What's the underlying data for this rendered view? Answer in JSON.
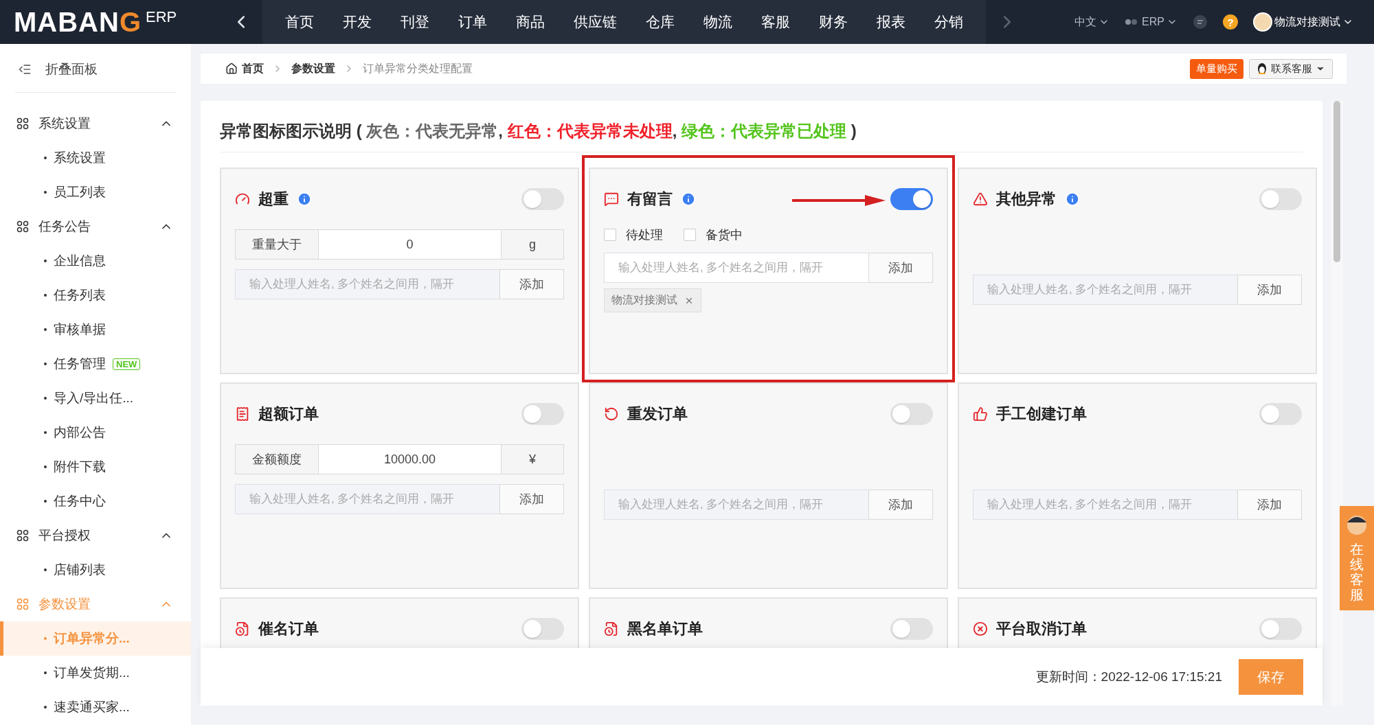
{
  "top_nav": {
    "logo": {
      "text": "MABAN",
      "mark": "G",
      "suffix": "ERP"
    },
    "items": [
      {
        "label": "首页",
        "selected": false
      },
      {
        "label": "开发",
        "selected": false
      },
      {
        "label": "刊登",
        "selected": false
      },
      {
        "label": "订单",
        "selected": false
      },
      {
        "label": "商品",
        "selected": false
      },
      {
        "label": "供应链",
        "selected": false
      },
      {
        "label": "仓库",
        "selected": false
      },
      {
        "label": "物流",
        "selected": false
      },
      {
        "label": "客服",
        "selected": false
      },
      {
        "label": "财务",
        "selected": false
      },
      {
        "label": "报表",
        "selected": false
      },
      {
        "label": "分销",
        "selected": false
      }
    ],
    "language": "中文",
    "system": "ERP",
    "help": "?",
    "user": "物流对接测试"
  },
  "sidebar": {
    "collapse_label": "折叠面板",
    "groups": [
      {
        "label": "系统设置",
        "expanded": true,
        "selected": false,
        "children": [
          {
            "label": "系统设置",
            "selected": false
          },
          {
            "label": "员工列表",
            "selected": false
          }
        ]
      },
      {
        "label": "任务公告",
        "expanded": true,
        "selected": false,
        "children": [
          {
            "label": "企业信息",
            "selected": false
          },
          {
            "label": "任务列表",
            "selected": false
          },
          {
            "label": "审核单据",
            "selected": false
          },
          {
            "label": "任务管理",
            "selected": false,
            "badge": "NEW"
          },
          {
            "label": "导入/导出任...",
            "selected": false
          },
          {
            "label": "内部公告",
            "selected": false
          },
          {
            "label": "附件下载",
            "selected": false
          },
          {
            "label": "任务中心",
            "selected": false
          }
        ]
      },
      {
        "label": "平台授权",
        "expanded": true,
        "selected": false,
        "children": [
          {
            "label": "店铺列表",
            "selected": false
          }
        ]
      },
      {
        "label": "参数设置",
        "expanded": true,
        "selected": true,
        "children": [
          {
            "label": "订单异常分...",
            "selected": true
          },
          {
            "label": "订单发货期...",
            "selected": false
          },
          {
            "label": "速卖通买家...",
            "selected": false
          }
        ]
      }
    ]
  },
  "breadcrumb": [
    "首页",
    "参数设置",
    "订单异常分类处理配置"
  ],
  "header_actions": {
    "buy_button": "单量购买",
    "support": "联系客服"
  },
  "legend": {
    "title": "异常图标图示说明",
    "open": "(",
    "close": ")",
    "separator": ",",
    "items": [
      {
        "text": "灰色：代表无异常",
        "color": "#666666"
      },
      {
        "text": "红色：代表异常未处理",
        "color": "#f0202a"
      },
      {
        "text": "绿色：代表异常已处理",
        "color": "#52c41a"
      }
    ]
  },
  "cards": [
    {
      "title": "超重",
      "kind": "gauge",
      "info": true,
      "on": false,
      "highlighted": false,
      "threshold": {
        "label": "重量大于",
        "value": "0",
        "unit": "g"
      },
      "assignee": {
        "placeholder": "输入处理人姓名, 多个姓名之间用，隔开",
        "button": "添加"
      }
    },
    {
      "title": "有留言",
      "kind": "message",
      "info": true,
      "on": true,
      "highlighted": true,
      "checkboxes": [
        {
          "label": "待处理",
          "checked": false
        },
        {
          "label": "备货中",
          "checked": false
        }
      ],
      "assignee": {
        "placeholder": "输入处理人姓名, 多个姓名之间用，隔开",
        "button": "添加"
      },
      "tags": [
        "物流对接测试"
      ]
    },
    {
      "title": "其他异常",
      "kind": "warning",
      "info": true,
      "on": false,
      "highlighted": false,
      "assignee": {
        "placeholder": "输入处理人姓名, 多个姓名之间用，隔开",
        "button": "添加"
      }
    },
    {
      "title": "超额订单",
      "kind": "invoice",
      "info": false,
      "on": false,
      "highlighted": false,
      "threshold": {
        "label": "金额额度",
        "value": "10000.00",
        "unit": "¥"
      },
      "assignee": {
        "placeholder": "输入处理人姓名, 多个姓名之间用，隔开",
        "button": "添加"
      }
    },
    {
      "title": "重发订单",
      "kind": "redo",
      "info": false,
      "on": false,
      "highlighted": false,
      "assignee": {
        "placeholder": "输入处理人姓名, 多个姓名之间用，隔开",
        "button": "添加"
      }
    },
    {
      "title": "手工创建订单",
      "kind": "thumb",
      "info": false,
      "on": false,
      "highlighted": false,
      "assignee": {
        "placeholder": "输入处理人姓名, 多个姓名之间用，隔开",
        "button": "添加"
      }
    },
    {
      "title": "催名订单",
      "kind": "list",
      "info": false,
      "on": false,
      "highlighted": false
    },
    {
      "title": "黑名单订单",
      "kind": "list",
      "info": false,
      "on": false,
      "highlighted": false
    },
    {
      "title": "平台取消订单",
      "kind": "cancel",
      "info": false,
      "on": false,
      "highlighted": false
    }
  ],
  "footer": {
    "updated": "更新时间：2022-12-06 17:15:21",
    "save": "保存"
  },
  "online_service": "在线客服"
}
